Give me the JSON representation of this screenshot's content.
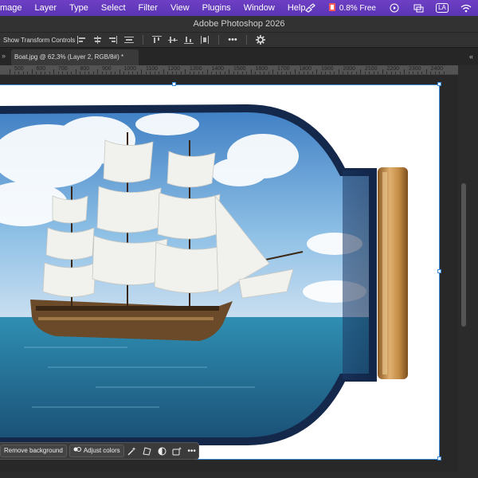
{
  "menubar": {
    "items": [
      "mage",
      "Layer",
      "Type",
      "Select",
      "Filter",
      "View",
      "Plugins",
      "Window",
      "Help"
    ],
    "status_text": "0.8% Free",
    "language_badge": "LA"
  },
  "app_title": "Adobe Photoshop 2026",
  "options": {
    "show_transform_label": "Show Transform Controls"
  },
  "document_tab": {
    "title": "Boat.jpg @ 62,3% (Layer 2, RGB/8#) *"
  },
  "ruler": {
    "labels": [
      "500",
      "600",
      "700",
      "800",
      "900",
      "1000",
      "1100",
      "1200",
      "1300",
      "1400",
      "1500",
      "1600",
      "1700",
      "1800",
      "1900",
      "2000",
      "2100",
      "2200",
      "2300",
      "2400"
    ]
  },
  "taskbar": {
    "remove_bg_label": "Remove background",
    "adjust_colors_label": "Adjust colors"
  },
  "colors": {
    "menubar": "#5f38bb",
    "selection": "#3c8ce0",
    "bottle_glass": "#1f3b66",
    "sea": "#2e7fa0",
    "cork": "#c08a45"
  }
}
